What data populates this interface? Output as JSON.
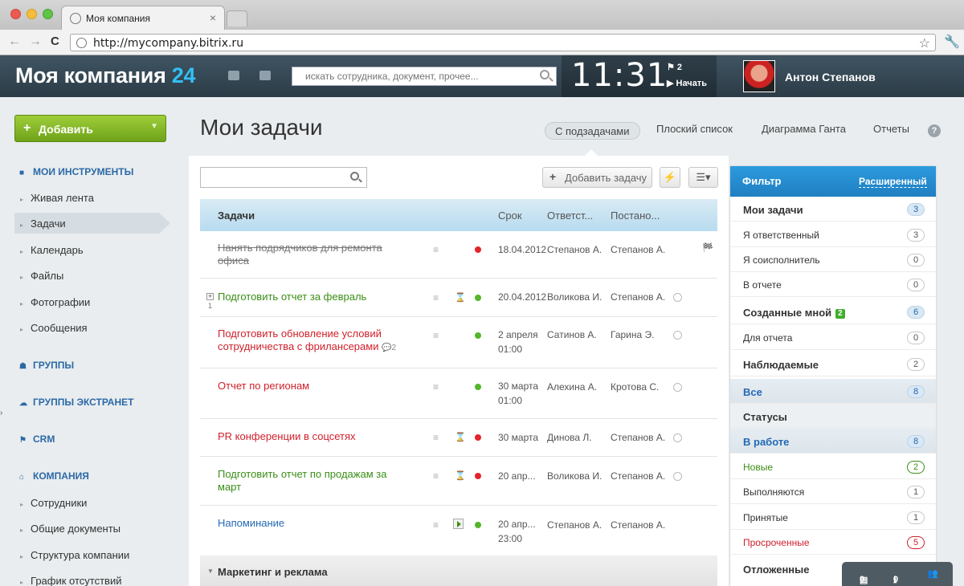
{
  "browser": {
    "tab_title": "Моя компания",
    "url": "http://mycompany.bitrix.ru"
  },
  "header": {
    "logo_text": "Моя компания",
    "logo_number": "24",
    "search_placeholder": "искать сотрудника, документ, прочее...",
    "clock": "11:31",
    "flag_count": "2",
    "start_label": "Начать",
    "user_name": "Антон Степанов"
  },
  "sidebar": {
    "add_label": "Добавить",
    "sections": {
      "tools": "МОИ ИНСТРУМЕНТЫ",
      "groups": "ГРУППЫ",
      "extranet": "ГРУППЫ ЭКСТРАНЕТ",
      "crm": "CRM",
      "company": "КОМПАНИЯ"
    },
    "tools_items": [
      "Живая лента",
      "Задачи",
      "Календарь",
      "Файлы",
      "Фотографии",
      "Сообщения"
    ],
    "company_items": [
      "Сотрудники",
      "Общие документы",
      "Структура компании",
      "График отсутствий"
    ]
  },
  "main": {
    "title": "Мои задачи",
    "view_tabs": [
      "С подзадачами",
      "Плоский список",
      "Диаграмма Ганта",
      "Отчеты"
    ],
    "add_task_label": "Добавить задачу",
    "columns": {
      "title": "Задачи",
      "deadline": "Срок",
      "responsible": "Ответст...",
      "creator": "Постано..."
    },
    "tasks": [
      {
        "title": "Нанять подрядчиков для ремонта офиса",
        "deadline": "18.04.2012",
        "responsible": "Степанов А.",
        "creator": "Степанов А."
      },
      {
        "title": "Подготовить отчет за февраль",
        "subtasks": "1",
        "deadline": "20.04.2012",
        "responsible": "Воликова И.",
        "creator": "Степанов А."
      },
      {
        "title": "Подготовить обновление условий сотрудничества с фрилансерами",
        "comments": "2",
        "deadline": "2 апреля",
        "deadline_time": "01:00",
        "responsible": "Сатинов А.",
        "creator": "Гарина Э."
      },
      {
        "title": "Отчет по регионам",
        "deadline": "30 марта",
        "deadline_time": "01:00",
        "responsible": "Алехина А.",
        "creator": "Кротова С."
      },
      {
        "title": "PR конференции в соцсетях",
        "deadline": "30 марта",
        "responsible": "Динова Л.",
        "creator": "Степанов А."
      },
      {
        "title": "Подготовить отчет по продажам за март",
        "deadline": "20 апр...",
        "responsible": "Воликова И.",
        "creator": "Степанов А."
      },
      {
        "title": "Напоминание",
        "deadline": "20 апр...",
        "deadline_time": "23:00",
        "responsible": "Степанов А.",
        "creator": "Степанов А."
      }
    ],
    "group_label": "Маркетинг и реклама"
  },
  "filter": {
    "title": "Фильтр",
    "advanced": "Расширенный",
    "items": [
      {
        "label": "Мои задачи",
        "count": "3"
      },
      {
        "label": "Я ответственный",
        "count": "3"
      },
      {
        "label": "Я соисполнитель",
        "count": "0"
      },
      {
        "label": "В отчете",
        "count": "0"
      },
      {
        "label": "Созданные мной",
        "badge": "2",
        "count": "6"
      },
      {
        "label": "Для отчета",
        "count": "0"
      },
      {
        "label": "Наблюдаемые",
        "count": "2"
      },
      {
        "label": "Все",
        "count": "8"
      },
      {
        "label": "Статусы"
      },
      {
        "label": "В работе",
        "count": "8"
      },
      {
        "label": "Новые",
        "count": "2"
      },
      {
        "label": "Выполняются",
        "count": "1"
      },
      {
        "label": "Принятые",
        "count": "1"
      },
      {
        "label": "Просроченные",
        "count": "5"
      },
      {
        "label": "Отложенные"
      }
    ]
  },
  "bottom_bar": {
    "messages": "0",
    "notifications": "0"
  },
  "colors": {
    "accent_blue": "#2469b3",
    "add_green": "#7cb32a",
    "header_dark": "#2f404b",
    "overdue_red": "#d0212c"
  }
}
